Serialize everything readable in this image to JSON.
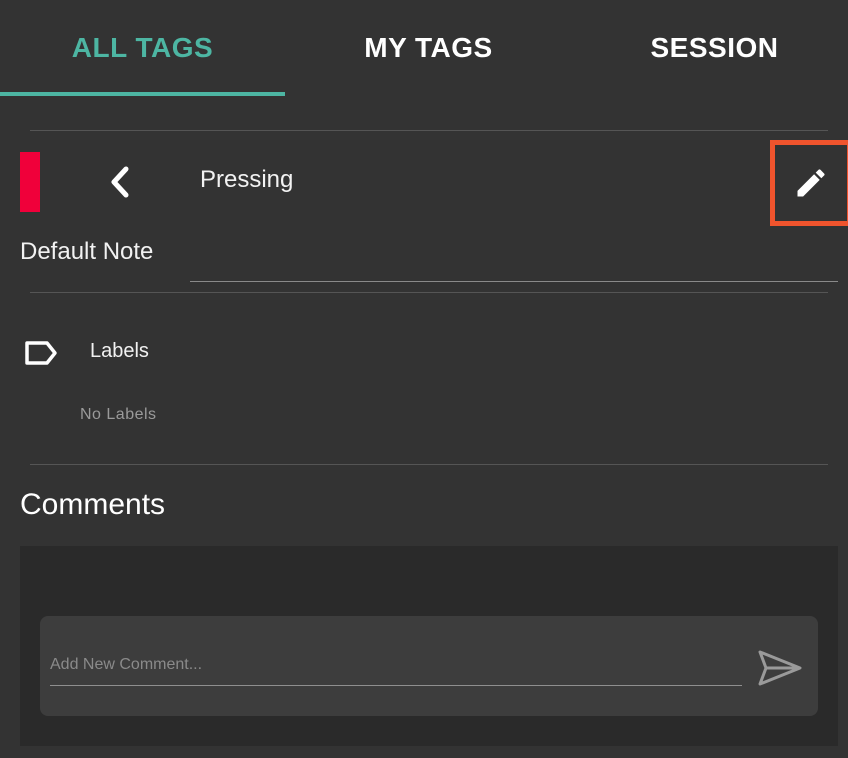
{
  "tabs": [
    {
      "label": "ALL TAGS",
      "active": true
    },
    {
      "label": "MY TAGS",
      "active": false
    },
    {
      "label": "SESSION",
      "active": false
    }
  ],
  "colors": {
    "accent": "#4db6a3",
    "tag_color": "#f0003a",
    "highlight": "#f0542d",
    "background": "#333333",
    "panel": "#2a2a2a"
  },
  "tag": {
    "name": "Pressing",
    "back_icon": "chevron-left-icon",
    "edit_icon": "pencil-icon"
  },
  "note": {
    "label": "Default Note",
    "value": ""
  },
  "labels": {
    "title": "Labels",
    "icon": "tag-outline-icon",
    "empty_text": "No Labels"
  },
  "comments": {
    "title": "Comments",
    "placeholder": "Add New Comment...",
    "send_icon": "send-icon"
  }
}
